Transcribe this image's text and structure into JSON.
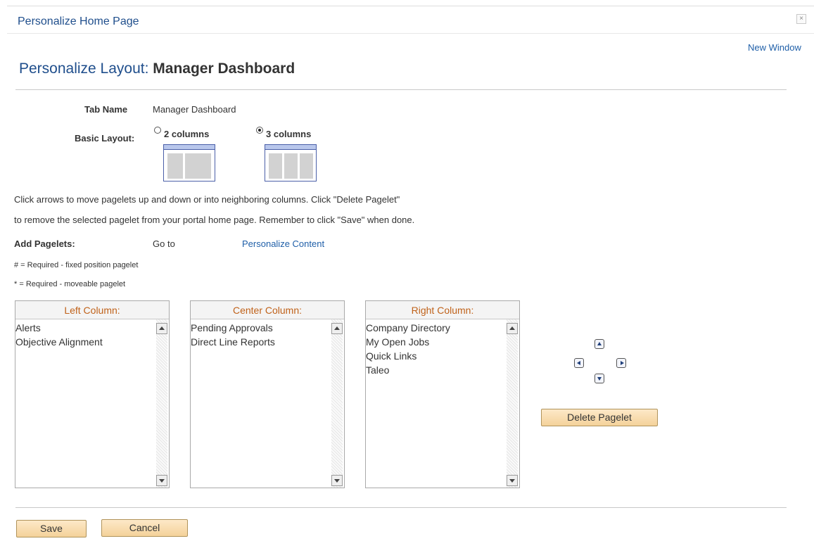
{
  "header": {
    "title": "Personalize Home Page",
    "close_glyph": "×"
  },
  "new_window_link": "New Window",
  "page_heading": {
    "prefix": "Personalize Layout:",
    "name": "Manager Dashboard"
  },
  "tab_name": {
    "label": "Tab Name",
    "value": "Manager Dashboard"
  },
  "basic_layout": {
    "label": "Basic Layout:",
    "options": [
      {
        "label": "2 columns",
        "checked": false
      },
      {
        "label": "3 columns",
        "checked": true
      }
    ]
  },
  "instructions": {
    "line1": "Click arrows to move pagelets up and down or into neighboring columns. Click \"Delete Pagelet\"",
    "line2": "to remove the selected pagelet from your portal home page. Remember to click \"Save\" when done."
  },
  "add_pagelets": {
    "label": "Add Pagelets:",
    "goto": "Go to",
    "link": "Personalize Content"
  },
  "legend": {
    "fixed": "# = Required - fixed position pagelet",
    "moveable": "* = Required - moveable pagelet"
  },
  "columns": [
    {
      "header": "Left Column:",
      "items": [
        "Alerts",
        "Objective Alignment"
      ]
    },
    {
      "header": "Center Column:",
      "items": [
        "Pending Approvals",
        "Direct Line Reports"
      ]
    },
    {
      "header": "Right Column:",
      "items": [
        "Company Directory",
        "My Open Jobs",
        "Quick Links",
        "Taleo"
      ]
    }
  ],
  "delete_button": "Delete Pagelet",
  "footer": {
    "save": "Save",
    "cancel": "Cancel"
  },
  "colors": {
    "title_blue": "#1f4e8c",
    "column_header": "#c0621a",
    "button_face": "#f4d29a"
  }
}
